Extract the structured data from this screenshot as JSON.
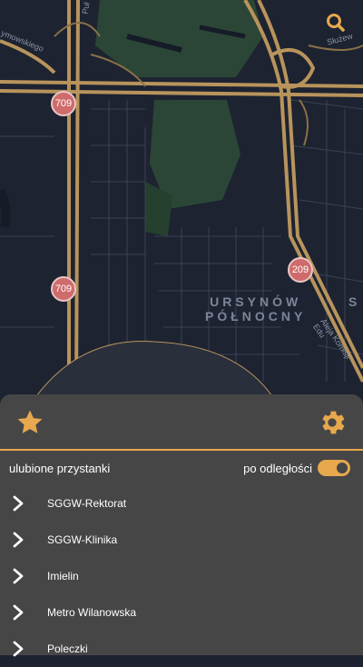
{
  "map": {
    "search_icon": "search-icon",
    "route_badges": [
      "709",
      "709",
      "209"
    ],
    "streets": {
      "top_left": "ymowskiego",
      "top_vertical": "Puł",
      "top_right": "Służew",
      "lower_right": "Aleja Komisji Edu"
    },
    "district": {
      "line1": "URSYNÓW",
      "line2": "PÓŁNOCNY",
      "edge": "S"
    },
    "colors": {
      "background": "#1d2331",
      "roads": "#b8945c",
      "park": "#2e4a3a"
    }
  },
  "panel": {
    "favorites_icon": "star-icon",
    "settings_icon": "gear-icon",
    "filter_label": "ulubione przystanki",
    "sort_label": "po odległości",
    "sort_toggle_on": true,
    "accent_color": "#e7a84e",
    "stops": [
      {
        "name": "SGGW-Rektorat"
      },
      {
        "name": "SGGW-Klinika"
      },
      {
        "name": "Imielin"
      },
      {
        "name": "Metro Wilanowska"
      },
      {
        "name": "Poleczki"
      }
    ]
  }
}
